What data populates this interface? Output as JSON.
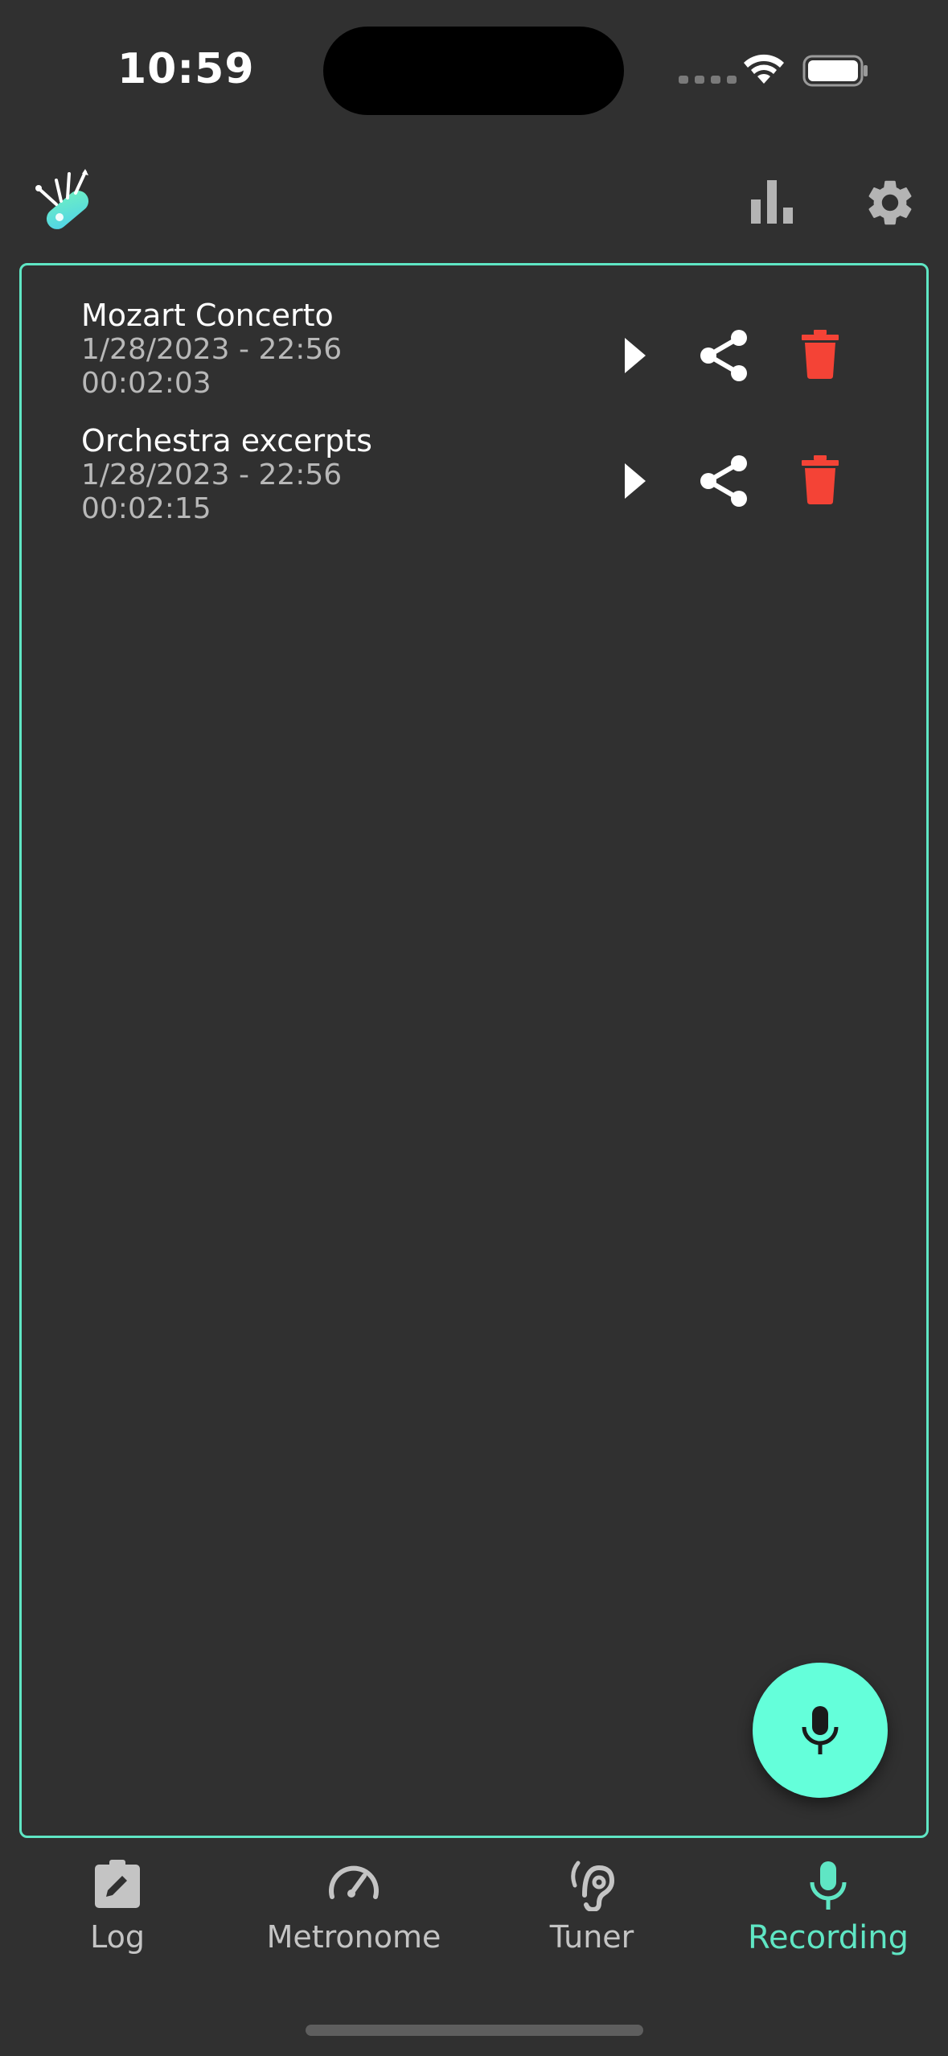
{
  "status_bar": {
    "time": "10:59"
  },
  "app_bar": {
    "logo_icon": "swiss-knife-logo",
    "stats_icon": "bar-chart-icon",
    "settings_icon": "gear-icon"
  },
  "recordings": [
    {
      "title": "Mozart Concerto",
      "date": "1/28/2023 - 22:56",
      "duration": "00:02:03"
    },
    {
      "title": "Orchestra excerpts",
      "date": "1/28/2023 - 22:56",
      "duration": "00:02:15"
    }
  ],
  "fab": {
    "icon": "microphone-icon"
  },
  "bottom_nav": {
    "items": [
      {
        "label": "Log",
        "icon": "clipboard-edit-icon",
        "active": false
      },
      {
        "label": "Metronome",
        "icon": "speedometer-icon",
        "active": false
      },
      {
        "label": "Tuner",
        "icon": "ear-icon",
        "active": false
      },
      {
        "label": "Recording",
        "icon": "microphone-icon",
        "active": true
      }
    ]
  },
  "colors": {
    "background": "#303030",
    "accent": "#5fe6c4",
    "fab": "#64ffda",
    "delete": "#f44336",
    "muted_text": "#b8b8b8"
  }
}
